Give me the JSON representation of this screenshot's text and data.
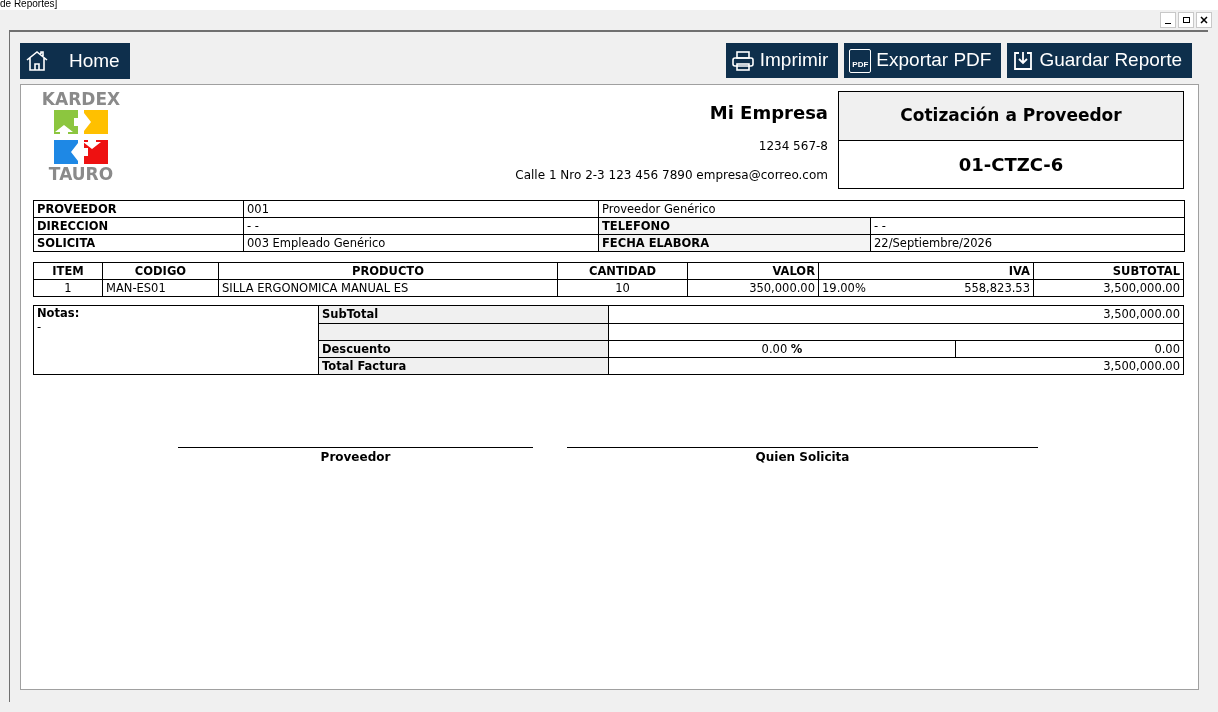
{
  "window": {
    "title": "de Reportes]"
  },
  "toolbar": {
    "home": "Home",
    "buttons": [
      {
        "kind": "print",
        "label": "Imprimir"
      },
      {
        "kind": "pdf",
        "label": "Exportar PDF",
        "icon_text": "PDF"
      },
      {
        "kind": "save",
        "label": "Guardar Reporte"
      }
    ]
  },
  "logo": {
    "top": "KARDEX",
    "bottom": "TAURO"
  },
  "company": {
    "name": "Mi Empresa",
    "id": "1234 567-8",
    "contact": "Calle 1 Nro 2-3 123 456 7890 empresa@correo.com"
  },
  "document": {
    "title": "Cotización a Proveedor",
    "number": "01-CTZC-6"
  },
  "info": [
    {
      "label": "PROVEEDOR",
      "value": "001",
      "extra": "Proveedor Genérico"
    },
    {
      "label": "DIRECCION",
      "value": "- -",
      "label2": "TELEFONO",
      "value2": "- -"
    },
    {
      "label": "SOLICITA",
      "value": "003 Empleado Genérico",
      "label2": "FECHA ELABORA",
      "value2": "22/Septiembre/2026"
    }
  ],
  "items": {
    "columns": [
      "ITEM",
      "CODIGO",
      "PRODUCTO",
      "CANTIDAD",
      "VALOR",
      "IVA",
      "SUBTOTAL"
    ],
    "rows": [
      {
        "item": "1",
        "codigo": "MAN-ES01",
        "producto": "SILLA ERGONOMICA MANUAL ES",
        "cantidad": "10",
        "valor": "350,000.00",
        "iva_rate": "19.00%",
        "iva": "558,823.53",
        "subtotal": "3,500,000.00"
      }
    ]
  },
  "notes": {
    "label": "Notas:",
    "text": "-"
  },
  "totals": [
    {
      "kind": "plain",
      "label": "SubTotal",
      "value": "3,500,000.00"
    },
    {
      "kind": "blank"
    },
    {
      "kind": "discount",
      "label": "Descuento",
      "percent": "0.00 **%**",
      "value": "0.00"
    },
    {
      "kind": "plain",
      "label": "Total Factura",
      "value": "3,500,000.00"
    }
  ],
  "signatures": [
    "Proveedor",
    "Quien Solicita"
  ]
}
